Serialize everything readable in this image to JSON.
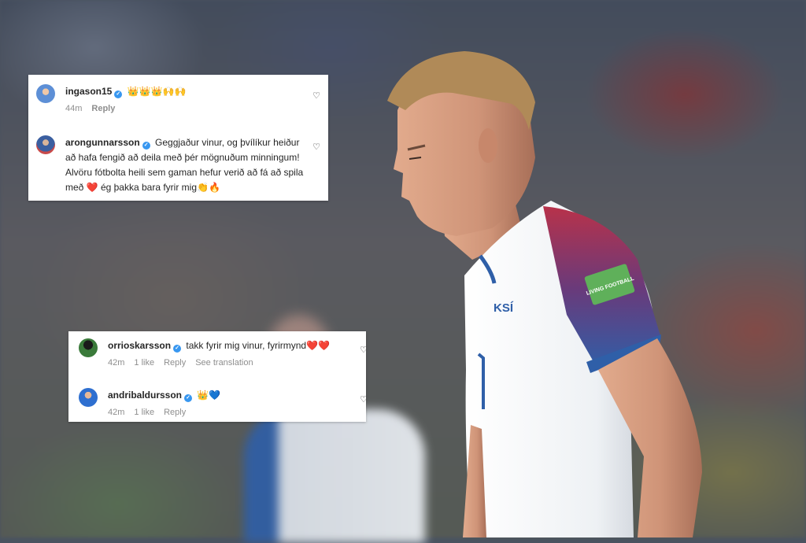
{
  "comments_top": [
    {
      "username": "ingason15",
      "text": "👑👑👑🙌🙌",
      "time": "44m",
      "reply": "Reply"
    },
    {
      "username": "arongunnarsson",
      "text": "Geggjaður vinur, og þvílíkur heiður að hafa fengið að deila með þér mögnuðum minningum! Alvöru fótbolta heili sem gaman hefur verið að fá að spila með ❤️ ég þakka bara fyrir mig👏🔥"
    }
  ],
  "comments_bottom": [
    {
      "username": "orrioskarsson",
      "text": "takk fyrir mig vinur, fyrirmynd❤️❤️",
      "time": "42m",
      "likes": "1 like",
      "reply": "Reply",
      "translate": "See translation"
    },
    {
      "username": "andribaldursson",
      "text": "👑💙",
      "time": "42m",
      "likes": "1 like",
      "reply": "Reply"
    }
  ],
  "icons": {
    "verified": "verified-badge-icon",
    "like": "heart-icon"
  },
  "jersey": {
    "crest": "KSÍ",
    "sleeve_badge": "LIVING FOOTBALL"
  },
  "colors": {
    "verified": "#3897f0",
    "meta_gray": "#8e8e8e",
    "text": "#262626",
    "jersey_blue": "#2f5fa8",
    "jersey_red": "#b8324a"
  }
}
